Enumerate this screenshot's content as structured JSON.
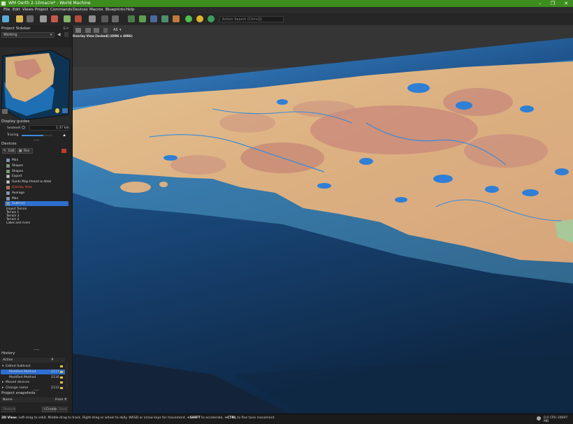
{
  "window": {
    "title": "WM Oerth 2-10macro* - World Machine",
    "minimize": "–",
    "maximize": "❒",
    "close": "✕",
    "titlebar_color": "#3c8c1e"
  },
  "menu": [
    "File",
    "Edit",
    "Views",
    "Project",
    "Commands",
    "Devices",
    "Macros",
    "Blueprints",
    "Help"
  ],
  "toolbar": {
    "search_placeholder": "Action Search (Ctrl+Q)"
  },
  "sidebar": {
    "title": "Project Sidebar",
    "layout_select": "Working",
    "display_guides": {
      "title": "Display guides",
      "sealevel_label": "Sealevel",
      "sealevel_value": "1.37 km",
      "tracing_label": "Tracing",
      "tracing_level": 0.7
    },
    "devices": {
      "title": "Devices",
      "edit_label": "Edit",
      "res_label": "Res",
      "items": [
        {
          "label": "Max",
          "color": "#6fa0d8",
          "selected": false
        },
        {
          "label": "Shapes",
          "color": "#5db05d",
          "selected": false
        },
        {
          "label": "Shapes",
          "color": "#5db05d",
          "selected": false
        },
        {
          "label": "Export",
          "color": "#c7c7c7",
          "selected": false
        },
        {
          "label": "Guide Map Hexed w detai",
          "color": "#cfcfcf",
          "selected": false
        },
        {
          "label": "Overlay View",
          "color": "#e0503c",
          "selected": false,
          "highlight": true
        },
        {
          "label": "Average",
          "color": "#6fa0d8",
          "selected": false
        },
        {
          "label": "Max",
          "color": "#6fa0d8",
          "selected": false
        },
        {
          "label": "Subtract",
          "color": "#6fa0d8",
          "selected": true
        }
      ],
      "plain_items": [
        "Import Terrain",
        "Terrain 1",
        "Terrain 3",
        "Terrain 4",
        "Lakes and rivers"
      ]
    },
    "history": {
      "title": "History",
      "col_action": "Action",
      "col_num": "#",
      "rows": [
        {
          "label": "Edited Subtract",
          "num": "",
          "indent": 0,
          "expanded": true
        },
        {
          "label": "Modified Method",
          "num": "2117",
          "indent": 1,
          "selected": true
        },
        {
          "label": "Modified Method",
          "num": "2116",
          "indent": 1
        },
        {
          "label": "Moved devices",
          "num": "",
          "indent": 0,
          "expanded": false
        },
        {
          "label": "Change name",
          "num": "2112",
          "indent": 0
        }
      ]
    },
    "snapshots": {
      "title": "Project snapshots",
      "col_name": "Name",
      "col_from": "From #",
      "restore_label": "Restore",
      "create_label": "+Create",
      "save_label": "Save"
    }
  },
  "viewport": {
    "caption": "Overlay View [locked] (4096 x 4096)",
    "mode_label": "AS"
  },
  "status": {
    "text_parts": [
      {
        "t": "3D View: ",
        "b": true
      },
      {
        "t": "Left-drag to orbit. Middle-drag to track. Right-drag or wheel to dolly. WASD or arrow keys for movement. ",
        "b": false
      },
      {
        "t": "+SHIFT",
        "b": true
      },
      {
        "t": " to accelerate, ",
        "b": false
      },
      {
        "t": "+CTRL",
        "b": true
      },
      {
        "t": " to fine tune movement.",
        "b": false
      }
    ],
    "right_text": "0.0 CPU 10697 MB"
  }
}
